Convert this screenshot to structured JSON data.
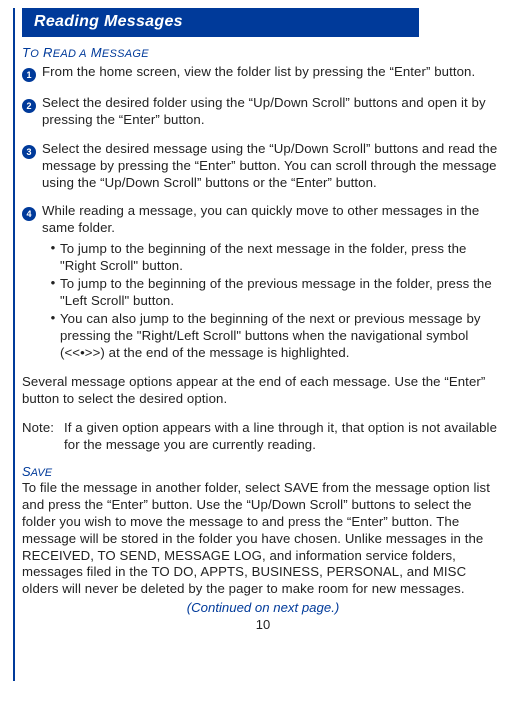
{
  "header": {
    "title": "Reading Messages"
  },
  "section_read": {
    "heading_html": "T<span style='font-size:11px'>O</span> R<span style='font-size:11px'>EAD A</span> M<span style='font-size:11px'>ESSAGE</span>",
    "steps": [
      {
        "n": "1",
        "text": "From the home screen, view the folder list by pressing the “Enter” button."
      },
      {
        "n": "2",
        "text": "Select the desired folder using the “Up/Down Scroll” buttons and open it by pressing the “Enter” button."
      },
      {
        "n": "3",
        "text": "Select the desired message using the “Up/Down Scroll” buttons and read the message by pressing the “Enter” button.  You can scroll through the message using the “Up/Down Scroll” buttons or the “Enter” button."
      },
      {
        "n": "4",
        "text": "While reading a message, you can quickly move to other messages in the same folder.",
        "subs": [
          "To jump to the beginning of the next message in the folder, press the \"Right Scroll\" button.",
          "To jump to the beginning of the previous message in the folder, press the \"Left Scroll\" button.",
          "You can also jump to the beginning of the next or previous message by pressing the \"Right/Left Scroll\" buttons when the navigational symbol (<<•>>) at the end of the message is highlighted."
        ]
      }
    ],
    "after": "Several message options appear at the end of each message. Use the “Enter” button to select the desired option.",
    "note_label": "Note:",
    "note": "If a given option appears with a line through it, that option is not available for the message you are currently reading."
  },
  "section_save": {
    "heading_html": "S<span style='font-size:11px'>AVE</span>",
    "text": "To file the message in another folder, select SAVE from the message option list and press the “Enter” button.  Use the “Up/Down Scroll” buttons to select the folder you wish to move the message to and press the “Enter” button. The message will be stored in the folder you have chosen.  Unlike messages in the RECEIVED, TO SEND, MESSAGE LOG, and information service folders, messages filed in the TO DO, APPTS, BUSINESS, PERSONAL, and MISC olders will never be deleted by the pager to make room for new messages."
  },
  "continued": "(Continued on next page.)",
  "page_number": "10"
}
